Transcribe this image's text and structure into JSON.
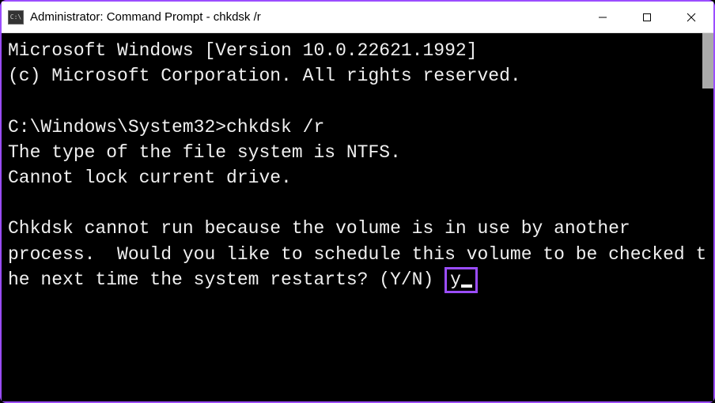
{
  "titlebar": {
    "icon_text": "C:\\",
    "title": "Administrator: Command Prompt - chkdsk  /r"
  },
  "console": {
    "line1": "Microsoft Windows [Version 10.0.22621.1992]",
    "line2": "(c) Microsoft Corporation. All rights reserved.",
    "blank1": "",
    "prompt": "C:\\Windows\\System32>",
    "command": "chkdsk /r",
    "line3": "The type of the file system is NTFS.",
    "line4": "Cannot lock current drive.",
    "blank2": "",
    "line5": "Chkdsk cannot run because the volume is in use by another",
    "line6": "process.  Would you like to schedule this volume to be checked the next time the system restarts? (Y/N) ",
    "input": "y"
  }
}
